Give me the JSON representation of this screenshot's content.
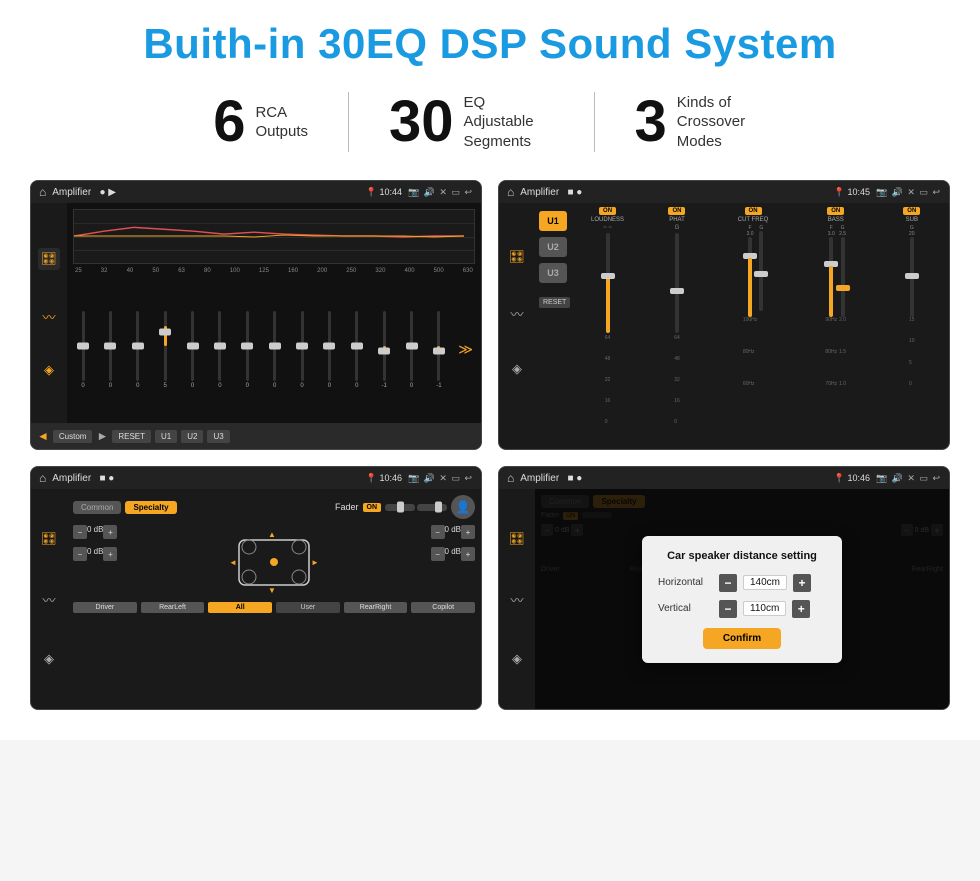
{
  "page": {
    "title": "Buith-in 30EQ DSP Sound System"
  },
  "stats": [
    {
      "number": "6",
      "text": "RCA\nOutputs"
    },
    {
      "number": "30",
      "text": "EQ Adjustable\nSegments"
    },
    {
      "number": "3",
      "text": "Kinds of\nCrossover Modes"
    }
  ],
  "screenshots": {
    "eq": {
      "topbar": {
        "title": "Amplifier",
        "time": "10:44"
      },
      "freqs": [
        "25",
        "32",
        "40",
        "50",
        "63",
        "80",
        "100",
        "125",
        "160",
        "200",
        "250",
        "320",
        "400",
        "500",
        "630"
      ],
      "values": [
        "0",
        "0",
        "0",
        "5",
        "0",
        "0",
        "0",
        "0",
        "0",
        "0",
        "0",
        "-1",
        "0",
        "-1"
      ],
      "buttons": [
        "Custom",
        "RESET",
        "U1",
        "U2",
        "U3"
      ]
    },
    "crossover": {
      "topbar": {
        "title": "Amplifier",
        "time": "10:45"
      },
      "units": [
        "U1",
        "U2",
        "U3"
      ],
      "channels": [
        "LOUDNESS",
        "PHAT",
        "CUT FREQ",
        "BASS",
        "SUB"
      ]
    },
    "fader": {
      "topbar": {
        "title": "Amplifier",
        "time": "10:46"
      },
      "tabs": [
        "Common",
        "Specialty"
      ],
      "faderLabel": "Fader",
      "onLabel": "ON",
      "dbValues": [
        "0 dB",
        "0 dB",
        "0 dB",
        "0 dB"
      ],
      "bottomBtns": [
        "Driver",
        "RearLeft",
        "All",
        "User",
        "RearRight",
        "Copilot"
      ]
    },
    "dialog": {
      "topbar": {
        "title": "Amplifier",
        "time": "10:46"
      },
      "tabs": [
        "Common",
        "Specialty"
      ],
      "dialogTitle": "Car speaker distance setting",
      "rows": [
        {
          "label": "Horizontal",
          "value": "140cm"
        },
        {
          "label": "Vertical",
          "value": "110cm"
        }
      ],
      "confirmBtn": "Confirm"
    }
  }
}
